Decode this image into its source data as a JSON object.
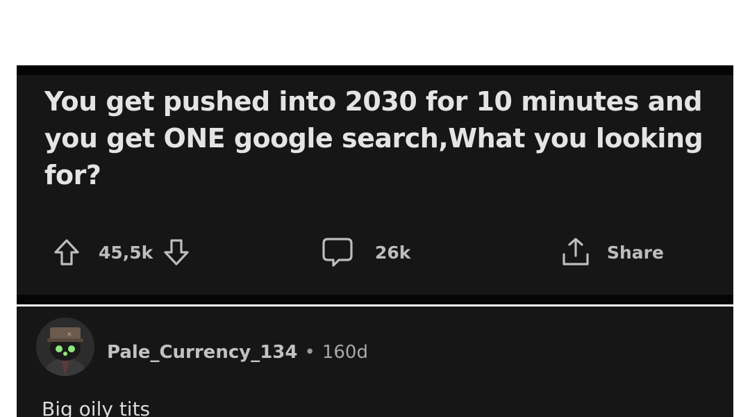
{
  "post": {
    "title": "You get pushed into 2030 for 10 minutes and you get ONE google search,What you looking for?",
    "votes": "45,5k",
    "comments": "26k",
    "share_label": "Share"
  },
  "comment": {
    "username": "Pale_Currency_134",
    "separator": "•",
    "age": "160d",
    "body": "Big oily tits"
  },
  "icons": {
    "upvote": "arrow-up-outline-icon",
    "downvote": "arrow-down-outline-icon",
    "comment": "speech-bubble-icon",
    "share": "share-upload-icon",
    "avatar": "robot-avatar-with-hat"
  },
  "colors": {
    "background": "#ffffff",
    "card": "#161616",
    "title_text": "#e4e4e4",
    "muted_text": "#bdbdbd",
    "avatar_eyes": "#8fe87a"
  }
}
